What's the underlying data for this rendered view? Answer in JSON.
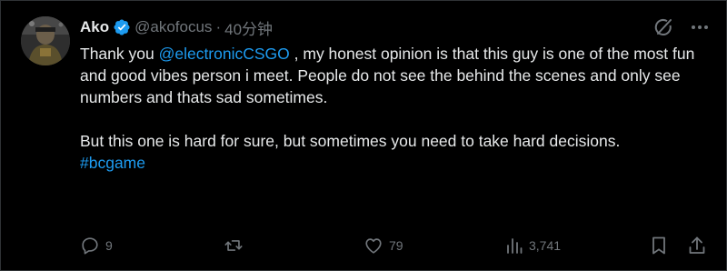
{
  "tweet": {
    "author_name": "Ako",
    "handle": "@akofocus",
    "separator": "·",
    "time": "40分钟",
    "mention": "@electronicCSGO",
    "text_before_mention": "Thank you ",
    "text_after_mention": " , my honest opinion is that this guy is one of the most fun and good vibes person i meet. People do not see the behind the scenes and only see numbers and thats sad sometimes.",
    "paragraph2": "But this one is hard for sure, but sometimes you need to take hard decisions.",
    "hashtag": "#bcgame"
  },
  "actions": {
    "replies": "9",
    "retweets": "",
    "likes": "79",
    "views": "3,741"
  },
  "colors": {
    "background": "#000000",
    "text": "#e7e9ea",
    "muted": "#71767b",
    "link": "#1d9bf0",
    "verified": "#1d9bf0",
    "border": "#2f3336"
  },
  "icons": {
    "verified": "verified-badge-icon",
    "grok": "grok-icon",
    "more": "more-icon",
    "reply": "reply-icon",
    "retweet": "retweet-icon",
    "like": "heart-icon",
    "views": "views-bar-chart-icon",
    "bookmark": "bookmark-icon",
    "share": "share-icon"
  }
}
